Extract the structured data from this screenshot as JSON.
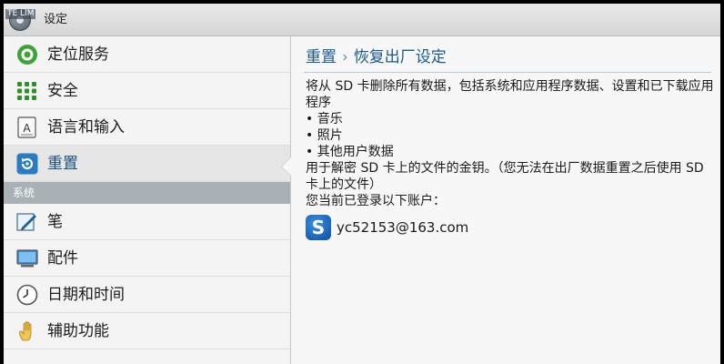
{
  "window": {
    "status_overlay": "TE LIM",
    "title": "设定"
  },
  "sidebar": {
    "items_top": [
      {
        "label": "定位服务",
        "icon": "location-icon"
      },
      {
        "label": "安全",
        "icon": "keypad-security-icon"
      },
      {
        "label": "语言和输入",
        "icon": "language-keyboard-icon"
      },
      {
        "label": "重置",
        "icon": "reset-icon",
        "selected": true
      }
    ],
    "section_label": "系统",
    "items_system": [
      {
        "label": "笔",
        "icon": "pen-icon"
      },
      {
        "label": "配件",
        "icon": "monitor-accessory-icon"
      },
      {
        "label": "日期和时间",
        "icon": "clock-icon"
      },
      {
        "label": "辅助功能",
        "icon": "hand-accessibility-icon"
      }
    ]
  },
  "content": {
    "breadcrumb_parent": "重置",
    "breadcrumb_separator": "›",
    "breadcrumb_current": "恢复出厂设定",
    "intro": "将从 SD 卡删除所有数据，包括系统和应用程序数据、设置和已下载应用程序",
    "bullets": [
      "• 音乐",
      "• 照片",
      "• 其他用户数据"
    ],
    "note": "用于解密 SD 卡上的文件的金钥。（您无法在出厂数据重置之后使用 SD 卡上的文件）",
    "accounts_label": "您当前已登录以下账户：",
    "account": {
      "icon_letter": "S",
      "name": "yc52153@163.com"
    }
  },
  "colors": {
    "accent": "#1d5a8c",
    "section_header": "#a9b0b6"
  }
}
